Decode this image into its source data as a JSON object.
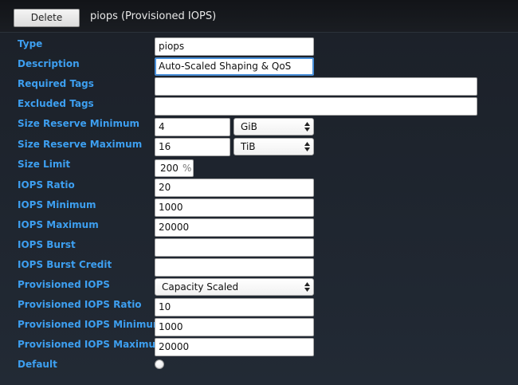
{
  "header": {
    "delete_label": "Delete",
    "title": "piops (Provisioned IOPS)"
  },
  "labels": {
    "type": "Type",
    "description": "Description",
    "required_tags": "Required Tags",
    "excluded_tags": "Excluded Tags",
    "size_reserve_min": "Size Reserve Minimum",
    "size_reserve_max": "Size Reserve Maximum",
    "size_limit": "Size Limit",
    "iops_ratio": "IOPS Ratio",
    "iops_min": "IOPS Minimum",
    "iops_max": "IOPS Maximum",
    "iops_burst": "IOPS Burst",
    "iops_burst_credit": "IOPS Burst Credit",
    "provisioned_iops": "Provisioned IOPS",
    "provisioned_iops_ratio": "Provisioned IOPS Ratio",
    "provisioned_iops_min": "Provisioned IOPS Minimum",
    "provisioned_iops_max": "Provisioned IOPS Maximum",
    "default": "Default"
  },
  "values": {
    "type": "piops",
    "description": "Auto-Scaled Shaping & QoS",
    "required_tags": "",
    "excluded_tags": "",
    "size_reserve_min": "4",
    "size_reserve_min_unit": "GiB",
    "size_reserve_max": "16",
    "size_reserve_max_unit": "TiB",
    "size_limit": "200",
    "size_limit_unit": "%",
    "iops_ratio": "20",
    "iops_min": "1000",
    "iops_max": "20000",
    "iops_burst": "",
    "iops_burst_credit": "",
    "provisioned_iops": "Capacity Scaled",
    "provisioned_iops_ratio": "10",
    "provisioned_iops_min": "1000",
    "provisioned_iops_max": "20000",
    "default_checked": false
  },
  "colors": {
    "label": "#3d9ff0",
    "background": "#1d232c",
    "focus": "#4a90d9"
  }
}
